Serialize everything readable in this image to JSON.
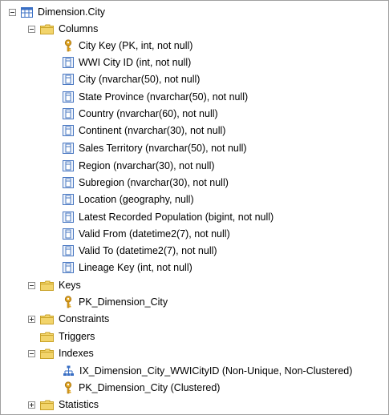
{
  "tree": {
    "table": {
      "label": "Dimension.City",
      "icon": "table-icon"
    },
    "columns_folder": {
      "label": "Columns",
      "icon": "folder-icon"
    },
    "columns": [
      {
        "label": "City Key (PK, int, not null)",
        "icon": "key-icon"
      },
      {
        "label": "WWI City ID (int, not null)",
        "icon": "column-icon"
      },
      {
        "label": "City (nvarchar(50), not null)",
        "icon": "column-icon"
      },
      {
        "label": "State Province (nvarchar(50), not null)",
        "icon": "column-icon"
      },
      {
        "label": "Country (nvarchar(60), not null)",
        "icon": "column-icon"
      },
      {
        "label": "Continent (nvarchar(30), not null)",
        "icon": "column-icon"
      },
      {
        "label": "Sales Territory (nvarchar(50), not null)",
        "icon": "column-icon"
      },
      {
        "label": "Region (nvarchar(30), not null)",
        "icon": "column-icon"
      },
      {
        "label": "Subregion (nvarchar(30), not null)",
        "icon": "column-icon"
      },
      {
        "label": "Location (geography, null)",
        "icon": "column-icon"
      },
      {
        "label": "Latest Recorded Population (bigint, not null)",
        "icon": "column-icon"
      },
      {
        "label": "Valid From (datetime2(7), not null)",
        "icon": "column-icon"
      },
      {
        "label": "Valid To (datetime2(7), not null)",
        "icon": "column-icon"
      },
      {
        "label": "Lineage Key (int, not null)",
        "icon": "column-icon"
      }
    ],
    "keys_folder": {
      "label": "Keys",
      "icon": "folder-icon"
    },
    "keys": [
      {
        "label": "PK_Dimension_City",
        "icon": "key-icon"
      }
    ],
    "constraints_folder": {
      "label": "Constraints",
      "icon": "folder-icon"
    },
    "triggers_folder": {
      "label": "Triggers",
      "icon": "folder-icon"
    },
    "indexes_folder": {
      "label": "Indexes",
      "icon": "folder-icon"
    },
    "indexes": [
      {
        "label": "IX_Dimension_City_WWICityID (Non-Unique, Non-Clustered)",
        "icon": "index-icon"
      },
      {
        "label": "PK_Dimension_City (Clustered)",
        "icon": "key-icon"
      }
    ],
    "statistics_folder": {
      "label": "Statistics",
      "icon": "folder-icon"
    }
  },
  "colors": {
    "folder_yellow": "#f2d46b",
    "table_blue": "#3a6fc4",
    "key_gold": "#e0a420"
  }
}
